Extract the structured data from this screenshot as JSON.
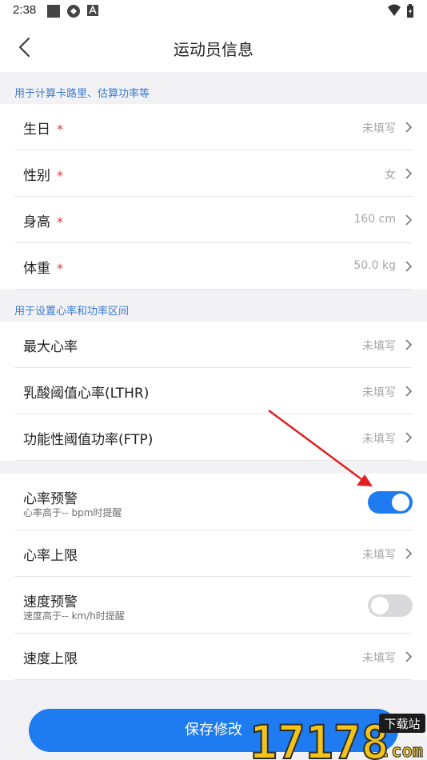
{
  "status_bar": {
    "time": "2:38"
  },
  "nav": {
    "title": "运动员信息"
  },
  "section1": {
    "label": "用于计算卡路里、估算功率等",
    "rows": [
      {
        "label": "生日",
        "value": "未填写",
        "required": true
      },
      {
        "label": "性别",
        "value": "女",
        "required": true
      },
      {
        "label": "身高",
        "value": "160 cm",
        "required": true
      },
      {
        "label": "体重",
        "value": "50.0 kg",
        "required": true
      }
    ]
  },
  "section2": {
    "label": "用于设置心率和功率区间",
    "rows": [
      {
        "label": "最大心率",
        "value": "未填写"
      },
      {
        "label": "乳酸阈值心率(LTHR)",
        "value": "未填写"
      },
      {
        "label": "功能性阈值功率(FTP)",
        "value": "未填写"
      }
    ]
  },
  "section3": {
    "rows": [
      {
        "label": "心率预警",
        "sub": "心率高于-- bpm时提醒",
        "toggle": true
      },
      {
        "label": "心率上限",
        "value": "未填写"
      },
      {
        "label": "速度预警",
        "sub": "速度高于-- km/h时提醒",
        "toggle": false
      },
      {
        "label": "速度上限",
        "value": "未填写"
      }
    ]
  },
  "required_mark": "*",
  "footer": {
    "save_label": "保存修改"
  },
  "watermark": {
    "number": "17178",
    "badge": "下载站",
    "domain": ".com"
  },
  "colors": {
    "accent": "#1e7bf0",
    "section_label": "#3a7bd5",
    "required": "#e53935",
    "annotation_arrow": "#e02020"
  }
}
